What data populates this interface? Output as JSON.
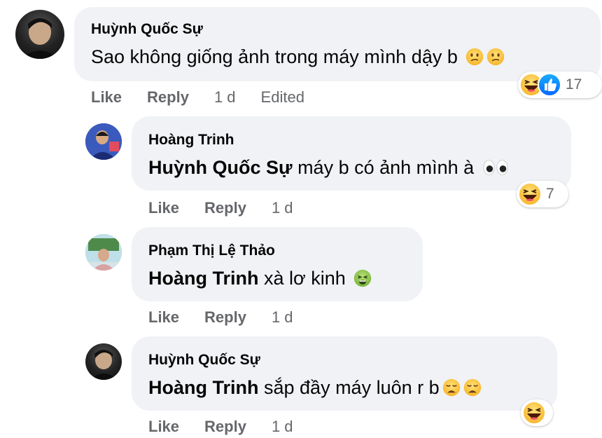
{
  "comments": [
    {
      "author": "Huỳnh Quốc Sự",
      "mention": "",
      "text": "Sao không giống ảnh trong máy mình dậy b",
      "emojis": [
        "confused-face-icon",
        "confused-face-icon"
      ],
      "actions": {
        "like": "Like",
        "reply": "Reply",
        "time": "1 d",
        "edited": "Edited"
      },
      "reactions": {
        "icons": [
          "laugh-reaction-icon",
          "like-reaction-icon"
        ],
        "count": "17"
      }
    },
    {
      "author": "Hoàng Trinh",
      "mention": "Huỳnh Quốc Sự",
      "text": " máy b có ảnh mình à",
      "emojis": [
        "eyes-icon"
      ],
      "actions": {
        "like": "Like",
        "reply": "Reply",
        "time": "1 d"
      },
      "reactions": {
        "icons": [
          "laugh-reaction-icon"
        ],
        "count": "7"
      }
    },
    {
      "author": "Phạm Thị Lệ Thảo",
      "mention": "Hoàng Trinh",
      "text": " xà lơ kinh",
      "emojis": [
        "nauseated-face-icon"
      ],
      "actions": {
        "like": "Like",
        "reply": "Reply",
        "time": "1 d"
      }
    },
    {
      "author": "Huỳnh Quốc Sự",
      "mention": "Hoàng Trinh",
      "text": " sắp đầy máy luôn r b",
      "emojis": [
        "weary-face-icon",
        "weary-face-icon"
      ],
      "actions": {
        "like": "Like",
        "reply": "Reply",
        "time": "1 d"
      },
      "reactions": {
        "icons": [
          "laugh-reaction-icon"
        ],
        "count": ""
      }
    }
  ]
}
